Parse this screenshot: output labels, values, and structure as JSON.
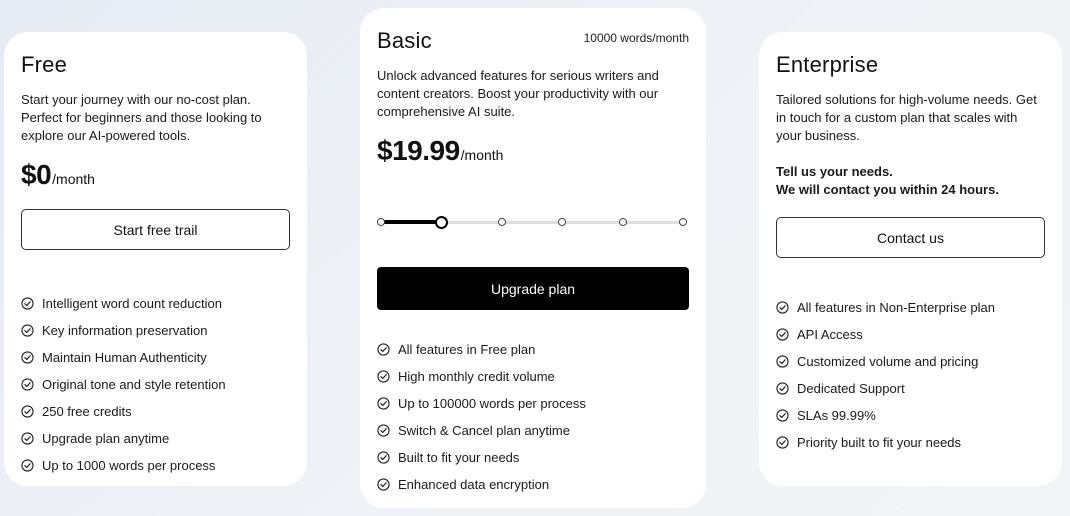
{
  "plans": {
    "free": {
      "name": "Free",
      "description": "Start your journey with our no-cost plan. Perfect for beginners and those looking to explore our AI-powered tools.",
      "price": "$0",
      "per": "/month",
      "button": "Start free trail",
      "features": [
        "Intelligent word count reduction",
        "Key information preservation",
        "Maintain Human Authenticity",
        "Original tone and style retention",
        "250 free credits",
        "Upgrade plan anytime",
        "Up to 1000 words per process"
      ]
    },
    "basic": {
      "name": "Basic",
      "words_per_month": "10000 words/month",
      "description": "Unlock advanced features for serious writers and content creators. Boost your productivity with our comprehensive AI suite.",
      "price": "$19.99",
      "per": "/month",
      "slider": {
        "steps": 6,
        "selected_index": 1
      },
      "button": "Upgrade plan",
      "features": [
        "All features in Free plan",
        "High monthly credit volume",
        "Up to 100000 words per process",
        "Switch & Cancel plan anytime",
        "Built to fit your needs",
        "Enhanced data encryption"
      ]
    },
    "enterprise": {
      "name": "Enterprise",
      "description": "Tailored solutions for high-volume needs. Get in touch for a custom plan that scales with your business.",
      "note_line1": "Tell us your needs.",
      "note_line2": "We will contact you within 24 hours.",
      "button": "Contact us",
      "features": [
        "All features in Non-Enterprise plan",
        "API Access",
        "Customized volume and pricing",
        "Dedicated Support",
        "SLAs 99.99%",
        "Priority built to fit your needs"
      ]
    }
  },
  "icons": {
    "feature": "check-circle-icon"
  },
  "colors": {
    "primary_button": "#000000",
    "background": "#eef1f6",
    "card": "#ffffff"
  }
}
